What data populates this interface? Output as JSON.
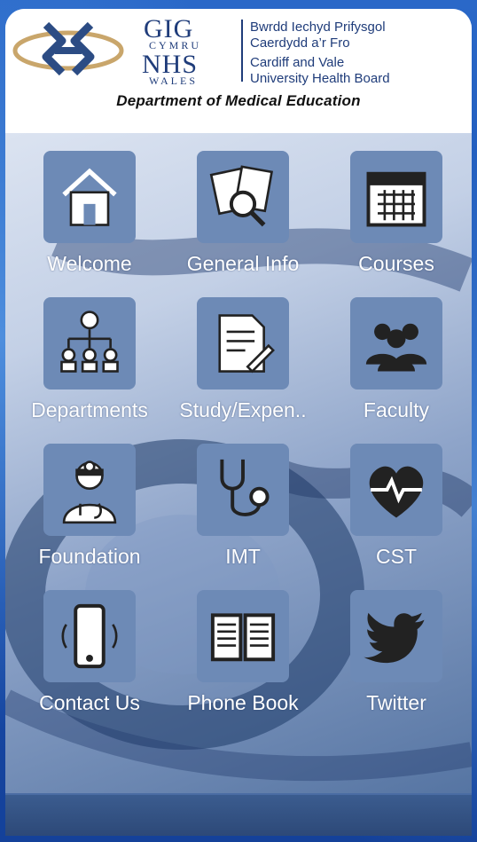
{
  "header": {
    "logo_gig": "GIG",
    "logo_cymru": "CYMRU",
    "logo_nhs": "NHS",
    "logo_wales": "WALES",
    "board_cy_1": "Bwrdd Iechyd Prifysgol",
    "board_cy_2": "Caerdydd a’r Fro",
    "board_en_1": "Cardiff and Vale",
    "board_en_2": "University Health Board",
    "department": "Department of Medical Education"
  },
  "menu": [
    {
      "label": "Welcome",
      "icon": "home-icon"
    },
    {
      "label": "General Info",
      "icon": "documents-search-icon"
    },
    {
      "label": "Courses",
      "icon": "calendar-icon"
    },
    {
      "label": "Departments",
      "icon": "org-chart-icon"
    },
    {
      "label": "Study/Expen..",
      "icon": "document-pen-icon"
    },
    {
      "label": "Faculty",
      "icon": "group-icon"
    },
    {
      "label": "Foundation",
      "icon": "doctor-icon"
    },
    {
      "label": "IMT",
      "icon": "stethoscope-icon"
    },
    {
      "label": "CST",
      "icon": "heart-pulse-icon"
    },
    {
      "label": "Contact Us",
      "icon": "phone-ringing-icon"
    },
    {
      "label": "Phone Book",
      "icon": "open-book-icon"
    },
    {
      "label": "Twitter",
      "icon": "twitter-bird-icon"
    }
  ],
  "colors": {
    "tile_bg": "#6d8ab6",
    "nhs_blue": "#1f3c7a",
    "background": "#1b54b5"
  }
}
